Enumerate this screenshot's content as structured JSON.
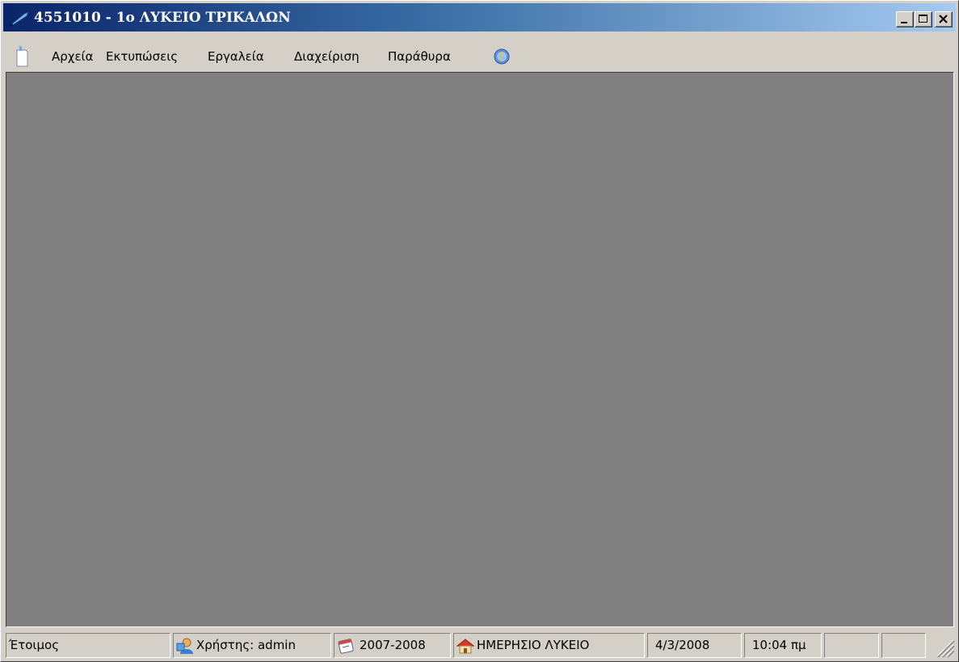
{
  "window": {
    "title": "4551010 - 1ο ΛΥΚΕΙΟ ΤΡΙΚΑΛΩΝ",
    "app_icon": "quill-pen-icon",
    "caption_buttons": [
      {
        "name": "minimize",
        "icon": "minimize-icon"
      },
      {
        "name": "maximize",
        "icon": "maximize-icon"
      },
      {
        "name": "close",
        "icon": "close-icon"
      }
    ]
  },
  "menubar": {
    "doc_icon": "document-icon",
    "items": [
      {
        "label": "Αρχεία"
      },
      {
        "label": "Εκτυπώσεις"
      },
      {
        "label": "Εργαλεία"
      },
      {
        "label": "Διαχείριση"
      },
      {
        "label": "Παράθυρα"
      }
    ],
    "help_icon": "info-icon"
  },
  "statusbar": {
    "status": "Έτοιμος",
    "user": {
      "icon": "user-icon",
      "text": "Χρήστης: admin"
    },
    "school_year": {
      "icon": "calendar-icon",
      "text": "2007-2008"
    },
    "school_type": {
      "icon": "house-icon",
      "text": "ΗΜΕΡΗΣΙΟ ΛΥΚΕΙΟ"
    },
    "date": "4/3/2008",
    "time": "10:04 πμ"
  },
  "colors": {
    "title_gradient_start": "#0a246a",
    "title_gradient_end": "#a6caf0",
    "mdi_background": "#808080",
    "face": "#d4d0c8"
  }
}
